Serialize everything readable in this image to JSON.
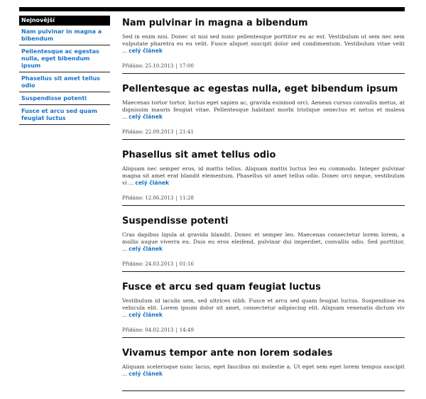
{
  "sidebar": {
    "heading": "Nejnovější",
    "items": [
      {
        "label": "Nam pulvinar in magna a bibendum"
      },
      {
        "label": "Pellentesque ac egestas nulla, eget bibendum ipsum"
      },
      {
        "label": "Phasellus sit amet tellus odio"
      },
      {
        "label": "Suspendisse potenti"
      },
      {
        "label": "Fusce et arcu sed quam feugiat luctus"
      }
    ]
  },
  "articles": [
    {
      "title": "Nam pulvinar in magna a bibendum",
      "excerpt": "Sed in enim nisi. Donec ut nisi sed nunc pellentesque porttitor eu ac est. Vestibulum ut sem nec sem vulputate pharetra eu eu velit. Fusce aliquet suscipit dolor sed condimentum. Vestibulum vitae velit ...",
      "more": "celý článek",
      "meta_label": "Přidáno:",
      "date": "25.10.2013",
      "time": "17:00"
    },
    {
      "title": "Pellentesque ac egestas nulla, eget bibendum ipsum",
      "excerpt": "Maecenas tortor tortor, luctus eget sapien ac, gravida euismod orci. Aenean cursus convallis metus, at dignissim mauris feugiat vitae. Pellentesque habitant morbi tristique senectus et netus et malesu ...",
      "more": "celý článek",
      "meta_label": "Přidáno:",
      "date": "22.09.2013",
      "time": "21:41"
    },
    {
      "title": "Phasellus sit amet tellus odio",
      "excerpt": "Aliquam nec semper eros, id mattis tellus. Aliquam mattis luctus leo eu commodo. Integer pulvinar magna sit amet erat blandit elementum. Phasellus sit amet tellus odio. Donec orci neque, vestibulum vi ...",
      "more": "celý článek",
      "meta_label": "Přidáno:",
      "date": "12.06.2013",
      "time": "11:28"
    },
    {
      "title": "Suspendisse potenti",
      "excerpt": "Cras dapibus ligula at gravida blandit. Donec et semper leo. Maecenas consectetur lorem lorem, a mollis augue viverra eu. Duis eu eros eleifend, pulvinar dui imperdiet, convallis odio. Sed porttitor, ...",
      "more": "celý článek",
      "meta_label": "Přidáno:",
      "date": "24.03.2013",
      "time": "01:16"
    },
    {
      "title": "Fusce et arcu sed quam feugiat luctus",
      "excerpt": "Vestibulum id iaculis sem, sed ultrices nibh. Fusce et arcu sed quam feugiat luctus. Suspendisse eu vehicula elit. Lorem ipsum dolor sit amet, consectetur adipiscing elit. Aliquam venenatis dictum viv ...",
      "more": "celý článek",
      "meta_label": "Přidáno:",
      "date": "04.02.2013",
      "time": "14:49"
    },
    {
      "title": "Vivamus tempor ante non lorem sodales",
      "excerpt": "Aliquam scelerisque nunc lacus, eget faucibus mi molestie a. Ut eget sem eget lorem tempus suscipit ...",
      "more": "celý článek",
      "meta_label": "Přidáno:",
      "date": "",
      "time": ""
    }
  ]
}
